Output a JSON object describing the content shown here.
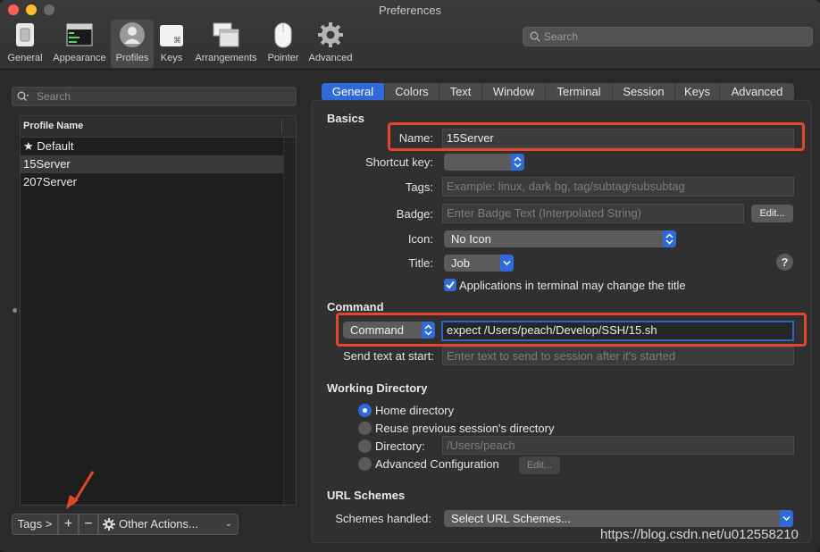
{
  "window": {
    "title": "Preferences"
  },
  "toolbar": {
    "items": [
      {
        "label": "General",
        "icon": "general-switch-icon"
      },
      {
        "label": "Appearance",
        "icon": "appearance-window-icon"
      },
      {
        "label": "Profiles",
        "icon": "profiles-person-icon",
        "selected": true
      },
      {
        "label": "Keys",
        "icon": "keys-command-icon"
      },
      {
        "label": "Arrangements",
        "icon": "arrangements-windows-icon"
      },
      {
        "label": "Pointer",
        "icon": "pointer-mouse-icon"
      },
      {
        "label": "Advanced",
        "icon": "advanced-gear-icon"
      }
    ],
    "search_placeholder": "Search"
  },
  "profiles": {
    "search_placeholder": "Search",
    "column_header": "Profile Name",
    "rows": [
      {
        "name": "★ Default"
      },
      {
        "name": "15Server",
        "selected": true
      },
      {
        "name": "207Server"
      }
    ],
    "bottom": {
      "tags_label": "Tags >",
      "add_label": "+",
      "remove_label": "−",
      "other_actions_label": "Other Actions...",
      "chevron": "⌄"
    }
  },
  "tabs": [
    "General",
    "Colors",
    "Text",
    "Window",
    "Terminal",
    "Session",
    "Keys",
    "Advanced"
  ],
  "basics": {
    "title": "Basics",
    "name_label": "Name:",
    "name_value": "15Server",
    "shortcut_label": "Shortcut key:",
    "tags_label": "Tags:",
    "tags_placeholder": "Example: linux, dark bg, tag/subtag/subsubtag",
    "badge_label": "Badge:",
    "badge_placeholder": "Enter Badge Text (Interpolated String)",
    "badge_edit": "Edit...",
    "icon_label": "Icon:",
    "icon_value": "No Icon",
    "title_label": "Title:",
    "title_value": "Job",
    "help": "?",
    "change_title_checkbox": "Applications in terminal may change the title"
  },
  "command": {
    "title": "Command",
    "mode_value": "Command",
    "command_value": "expect  /Users/peach/Develop/SSH/15.sh",
    "send_text_label": "Send text at start:",
    "send_text_placeholder": "Enter text to send to session after it's started"
  },
  "working_directory": {
    "title": "Working Directory",
    "home": "Home directory",
    "reuse": "Reuse previous session's directory",
    "directory": "Directory:",
    "directory_placeholder": "/Users/peach",
    "advanced": "Advanced Configuration",
    "advanced_edit": "Edit..."
  },
  "url_schemes": {
    "title": "URL Schemes",
    "handled_label": "Schemes handled:",
    "handled_value": "Select URL Schemes..."
  },
  "watermark": "https://blog.csdn.net/u012558210",
  "colors": {
    "accent": "#2f6ad9",
    "highlight": "#e2462c"
  }
}
